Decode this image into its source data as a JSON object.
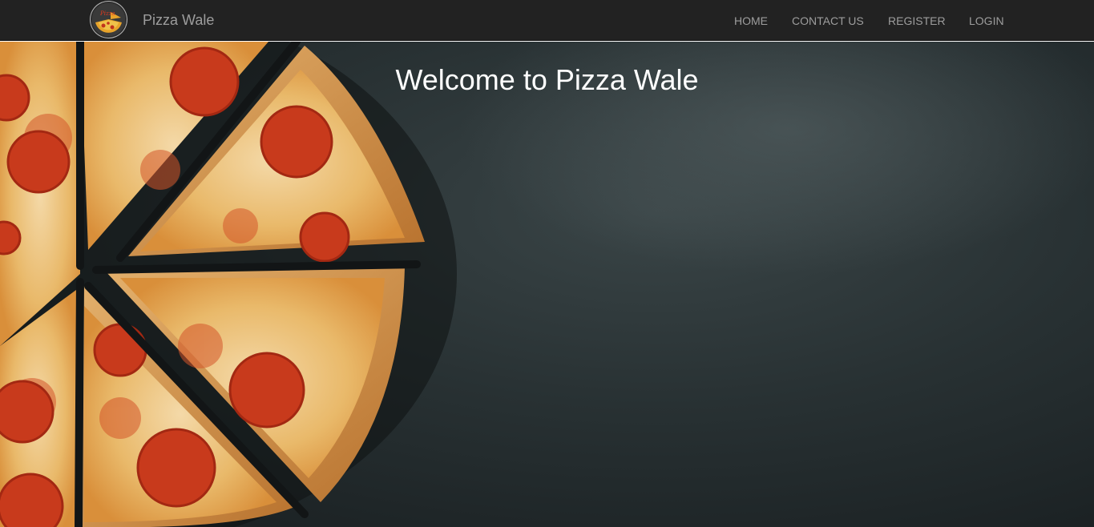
{
  "navbar": {
    "brand_name": "Pizza Wale",
    "logo": {
      "icon": "pizza-logo-icon",
      "text": "Pizza Wale"
    },
    "links": [
      {
        "label": "HOME"
      },
      {
        "label": "CONTACT US"
      },
      {
        "label": "REGISTER"
      },
      {
        "label": "LOGIN"
      }
    ]
  },
  "hero": {
    "title": "Welcome to Pizza Wale",
    "background_image": "pizza-slices-on-dark-stone-image"
  },
  "colors": {
    "navbar_bg": "#222222",
    "nav_text": "#9d9d9d",
    "hero_text": "#ffffff",
    "hero_bg": "#242b2c"
  }
}
